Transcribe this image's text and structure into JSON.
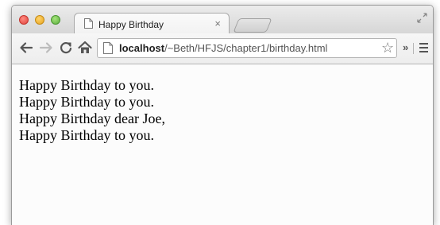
{
  "tab": {
    "title": "Happy Birthday",
    "close_glyph": "×"
  },
  "toolbar": {
    "url_host": "localhost",
    "url_path": "/~Beth/HFJS/chapter1/birthday.html",
    "icons": [
      "back-arrow-icon",
      "forward-arrow-icon",
      "reload-icon",
      "home-icon",
      "page-icon",
      "star-icon",
      "chevron-icon",
      "menu-icon"
    ]
  },
  "content": {
    "lines": [
      "Happy Birthday to you.",
      "Happy Birthday to you.",
      "Happy Birthday dear Joe,",
      "Happy Birthday to you."
    ]
  },
  "colors": {
    "close": "#e0443e",
    "minimize": "#e6a41f",
    "maximize": "#5cae3d"
  }
}
